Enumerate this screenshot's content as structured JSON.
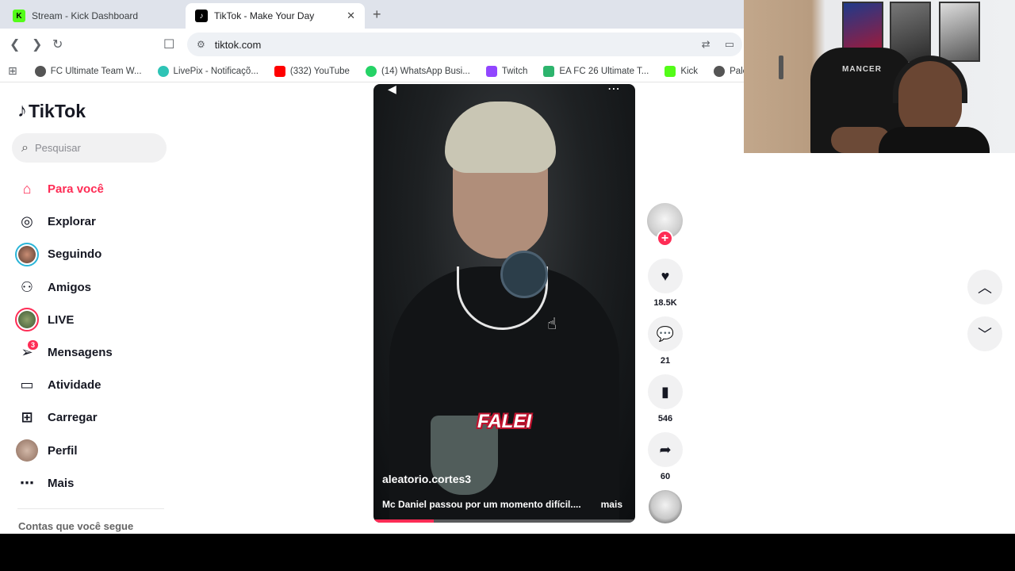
{
  "browser": {
    "tabs": [
      {
        "label": "Stream - Kick Dashboard",
        "favicon": "kick-favicon"
      },
      {
        "label": "TikTok - Make Your Day",
        "favicon": "tiktok-favicon",
        "active": true
      }
    ],
    "close_glyph": "✕",
    "new_tab_glyph": "+",
    "url": "tiktok.com",
    "bookmarks": [
      {
        "label": "FC Ultimate Team W...",
        "color": "#555555"
      },
      {
        "label": "LivePix - Notificaçõ...",
        "color": "#2ec4b6"
      },
      {
        "label": "(332) YouTube",
        "color": "#ff0000"
      },
      {
        "label": "(14) WhatsApp Busi...",
        "color": "#25d366"
      },
      {
        "label": "Twitch",
        "color": "#9146ff"
      },
      {
        "label": "EA FC 26 Ultimate T...",
        "color": "#2db46d"
      },
      {
        "label": "Kick",
        "color": "#53fc18"
      },
      {
        "label": "Paletools v",
        "color": "#555555"
      }
    ]
  },
  "tiktok": {
    "logo_text": "TikTok",
    "accent_color": "#fe2c55",
    "search_placeholder": "Pesquisar",
    "nav": [
      {
        "label": "Para você",
        "icon": "home-icon",
        "active": true
      },
      {
        "label": "Explorar",
        "icon": "compass-icon"
      },
      {
        "label": "Seguindo",
        "icon": "following-avatar"
      },
      {
        "label": "Amigos",
        "icon": "friends-icon"
      },
      {
        "label": "LIVE",
        "icon": "live-avatar"
      },
      {
        "label": "Mensagens",
        "icon": "messages-icon",
        "badge": "3"
      },
      {
        "label": "Atividade",
        "icon": "activity-icon"
      },
      {
        "label": "Carregar",
        "icon": "upload-icon"
      },
      {
        "label": "Perfil",
        "icon": "profile-avatar"
      },
      {
        "label": "Mais",
        "icon": "more-icon"
      }
    ],
    "following_header": "Contas que você segue"
  },
  "video": {
    "overlay_text": "FALEI",
    "author": "aleatorio.cortes3",
    "description": "Mc Daniel passou por um momento difícil....",
    "more_label": "mais",
    "progress": 0.23,
    "likes": "18.5K",
    "comments": "21",
    "saves": "546",
    "shares": "60"
  },
  "webcam": {
    "chair_brand": "MANCER"
  }
}
